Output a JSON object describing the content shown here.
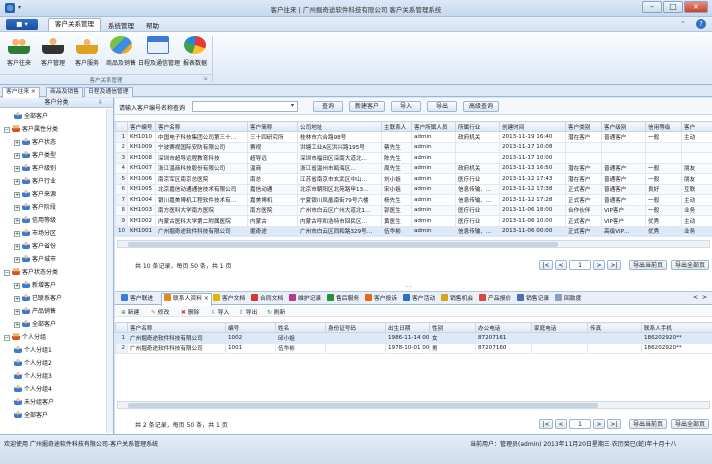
{
  "window": {
    "title": "客户往来 | 广州掘奇途软件科技有限公司 客户关系管理系统",
    "qa_icons": [
      "app-icon",
      "dropdown-icon"
    ],
    "controls": [
      "minimize-icon",
      "maximize-icon",
      "close-icon"
    ]
  },
  "menu": {
    "file": "■ ▾",
    "items": [
      "客户关系管理",
      "系统管理",
      "帮助"
    ],
    "active": 0
  },
  "ribbon": {
    "buttons": [
      {
        "label": "客户往来",
        "icon": "users-icon"
      },
      {
        "label": "客户管理",
        "icon": "customer-icon"
      },
      {
        "label": "客户服务",
        "icon": "service-icon"
      },
      {
        "label": "商品及销售",
        "icon": "goods-icon"
      },
      {
        "label": "日程及通信管理",
        "icon": "calendar-icon"
      },
      {
        "label": "报表数据",
        "icon": "report-icon"
      }
    ],
    "group_label": "客户关系管理"
  },
  "doc_tabs": [
    "客户往来 ×",
    "商品及销售",
    "日程及通信管理"
  ],
  "tree": {
    "header": "客户分类",
    "nodes": [
      {
        "label": "全部客户",
        "level": 1,
        "icon": "user"
      },
      {
        "label": "客户属性分类",
        "level": 0,
        "icon": "group",
        "exp": "−"
      },
      {
        "label": "客户状态",
        "level": 1,
        "icon": "user",
        "exp": "+"
      },
      {
        "label": "客户类型",
        "level": 1,
        "icon": "user",
        "exp": "+"
      },
      {
        "label": "客户级别",
        "level": 1,
        "icon": "user",
        "exp": "+"
      },
      {
        "label": "客户行业",
        "level": 1,
        "icon": "user",
        "exp": "+"
      },
      {
        "label": "客户来源",
        "level": 1,
        "icon": "user",
        "exp": "+"
      },
      {
        "label": "客户阶段",
        "level": 1,
        "icon": "user",
        "exp": "+"
      },
      {
        "label": "信用等级",
        "level": 1,
        "icon": "user",
        "exp": "+"
      },
      {
        "label": "市场分区",
        "level": 1,
        "icon": "user",
        "exp": "+"
      },
      {
        "label": "客户省份",
        "level": 1,
        "icon": "user",
        "exp": "+"
      },
      {
        "label": "客户城市",
        "level": 1,
        "icon": "user",
        "exp": "+"
      },
      {
        "label": "客户状态分类",
        "level": 0,
        "icon": "group",
        "exp": "−"
      },
      {
        "label": "新增客户",
        "level": 1,
        "icon": "user",
        "exp": "+"
      },
      {
        "label": "已联系客户",
        "level": 1,
        "icon": "user",
        "exp": "+"
      },
      {
        "label": "产品销售",
        "level": 1,
        "icon": "user",
        "exp": "+"
      },
      {
        "label": "全部客户",
        "level": 1,
        "icon": "user",
        "exp": "+"
      },
      {
        "label": "个人分组",
        "level": 0,
        "icon": "group",
        "exp": "−"
      },
      {
        "label": "个人分组1",
        "level": 1,
        "icon": "user"
      },
      {
        "label": "个人分组2",
        "level": 1,
        "icon": "user"
      },
      {
        "label": "个人分组3",
        "level": 1,
        "icon": "user"
      },
      {
        "label": "个人分组4",
        "level": 1,
        "icon": "user"
      },
      {
        "label": "未分组客户",
        "level": 1,
        "icon": "user"
      },
      {
        "label": "全部客户",
        "level": 1,
        "icon": "user"
      }
    ]
  },
  "search": {
    "label": "请输入客户编号名称查询",
    "value": "",
    "buttons": [
      "查询",
      "新建客户",
      "导入",
      "导出",
      "高级查询"
    ]
  },
  "customers": {
    "columns": [
      "",
      "客户编号",
      "客户名称",
      "客户简称",
      "公司地址",
      "主联系人",
      "客户所属人员",
      "所属行业",
      "创建时间",
      "客户类别",
      "客户级别",
      "信用等级",
      "客户"
    ],
    "rows": [
      [
        "1",
        "KH1010",
        "中国电子科技集团公司第三十…",
        "三十四研究所",
        "桂林市六合路98号",
        "",
        "admin",
        "政府机关",
        "2013-11-19 16:40",
        "潜在客户",
        "普通客户",
        "一般",
        "主动"
      ],
      [
        "2",
        "KH1009",
        "宁波赛视国际安防有限公司",
        "赛视",
        "洪塘工业A区洪兴路195号",
        "蔡先生",
        "admin",
        "",
        "2013-11-17 10:08",
        "",
        "",
        "",
        ""
      ],
      [
        "3",
        "KH1008",
        "深圳市超导远程教育科技",
        "超导远",
        "深圳市福田区深南大道北…",
        "陈先生",
        "admin",
        "",
        "2013-11-17 10:00",
        "",
        "",
        "",
        ""
      ],
      [
        "4",
        "KH1007",
        "浙江温商科技股份有限公司",
        "温商",
        "浙江省温州市瓯海区…",
        "周先生",
        "admin",
        "政府机关",
        "2013-11-13 16:50",
        "潜在客户",
        "普通客户",
        "一般",
        "朋友"
      ],
      [
        "5",
        "KH1006",
        "南京军区南京总医院",
        "南总",
        "江苏省南京市玄武区中山…",
        "刘小姐",
        "admin",
        "医疗行业",
        "2013-11-12 17:43",
        "潜在客户",
        "普通客户",
        "一般",
        "朋友"
      ],
      [
        "6",
        "KH1005",
        "北京嘉信动通通信技术有限公司",
        "嘉信动通",
        "北京市朝阳区北苑路甲13…",
        "宋小姐",
        "admin",
        "信息传输、…",
        "2013-11-12 17:38",
        "正式客户",
        "普通客户",
        "良好",
        "互联"
      ],
      [
        "7",
        "KH1004",
        "银川嘉美博机工程软件技术有…",
        "嘉美博机",
        "宁夏银川凤凰南街79号六楼",
        "杨先生",
        "admin",
        "信息传输、…",
        "2013-11-12 17:28",
        "正式客户",
        "普通客户",
        "一般",
        "主动"
      ],
      [
        "8",
        "KH1003",
        "南方医科大学南方医院",
        "南方医院",
        "广州市白云区广州大道北1…",
        "郭医生",
        "admin",
        "医疗行业",
        "2013-11-06 18:00",
        "合作伙伴",
        "VIP客户",
        "一般",
        "业务"
      ],
      [
        "9",
        "KH1002",
        "内蒙古医科大学第二附属医院",
        "内蒙古",
        "内蒙古呼和浩特市回民区…",
        "黄医生",
        "admin",
        "医疗行业",
        "2013-11-06 10:00",
        "正式客户",
        "VIP客户",
        "优秀",
        "主动"
      ],
      [
        "10",
        "KH1001",
        "广州掘奇途软件科技有限公司",
        "掘奇途",
        "广州市白云区同和路329号…",
        "伍华彬",
        "admin",
        "信息传输、…",
        "2013-11-06 00:00",
        "正式客户",
        "高级VIP…",
        "优秀",
        "业务"
      ]
    ],
    "selected_row": 9,
    "summary": "共 10 条记录，每页 50 条，共 1 页",
    "pager": {
      "first": "|<",
      "prev": "<",
      "page": "1",
      "next": ">",
      "last": ">|",
      "export_page": "导出当前页",
      "export_all": "导出全部页"
    }
  },
  "sub_tabs": [
    {
      "label": "客户联进",
      "icon": "#3c7fd0"
    },
    {
      "label": "联系人资料 ×",
      "icon": "#e08a1e",
      "active": true
    },
    {
      "label": "客户文档",
      "icon": "#e5b400"
    },
    {
      "label": "合同文档",
      "icon": "#d23a2a"
    },
    {
      "label": "维护记录",
      "icon": "#b83a8f"
    },
    {
      "label": "售后服务",
      "icon": "#2e8f3a"
    },
    {
      "label": "客户投诉",
      "icon": "#e46a1a"
    },
    {
      "label": "客户活动",
      "icon": "#2d6fc0"
    },
    {
      "label": "销售机会",
      "icon": "#d9a21b"
    },
    {
      "label": "产品报价",
      "icon": "#d74a3b"
    },
    {
      "label": "销售记录",
      "icon": "#4c6fb0"
    },
    {
      "label": "回款度",
      "icon": "#8a9fc0"
    }
  ],
  "sub_nav": [
    "<",
    ">"
  ],
  "contact_toolbar": [
    "新建",
    "修改",
    "删除",
    "导入",
    "导出",
    "刷新"
  ],
  "contacts": {
    "columns": [
      "",
      "客户名称",
      "编号",
      "姓名",
      "身份证号码",
      "出生日期",
      "性别",
      "办公电话",
      "家庭电话",
      "传真",
      "联系人手机"
    ],
    "rows": [
      [
        "1",
        "广州掘奇途软件科技有限公司",
        "1002",
        "邱小姐",
        "",
        "1986-11-14 00…",
        "女",
        "87207161",
        "",
        "",
        "186202920**"
      ],
      [
        "2",
        "广州掘奇途软件科技有限公司",
        "1001",
        "伍华彬",
        "",
        "1978-10-01 00…",
        "男",
        "87207160",
        "",
        "",
        "186202920**"
      ]
    ],
    "selected_row": 0,
    "summary": "共 2 条记录，每页 50 条，共 1 页",
    "pager": {
      "first": "|<",
      "prev": "<",
      "page": "1",
      "next": ">",
      "last": ">|",
      "export_page": "导出当前页",
      "export_all": "导出全部页"
    }
  },
  "status": {
    "left": "欢迎使用 广州掘奇途软件科技有限公司-客户关系管理系统",
    "right": "当前用户：管理员(admin)  2013年11月20日星期三  农历癸巳(蛇)年十月十八"
  }
}
